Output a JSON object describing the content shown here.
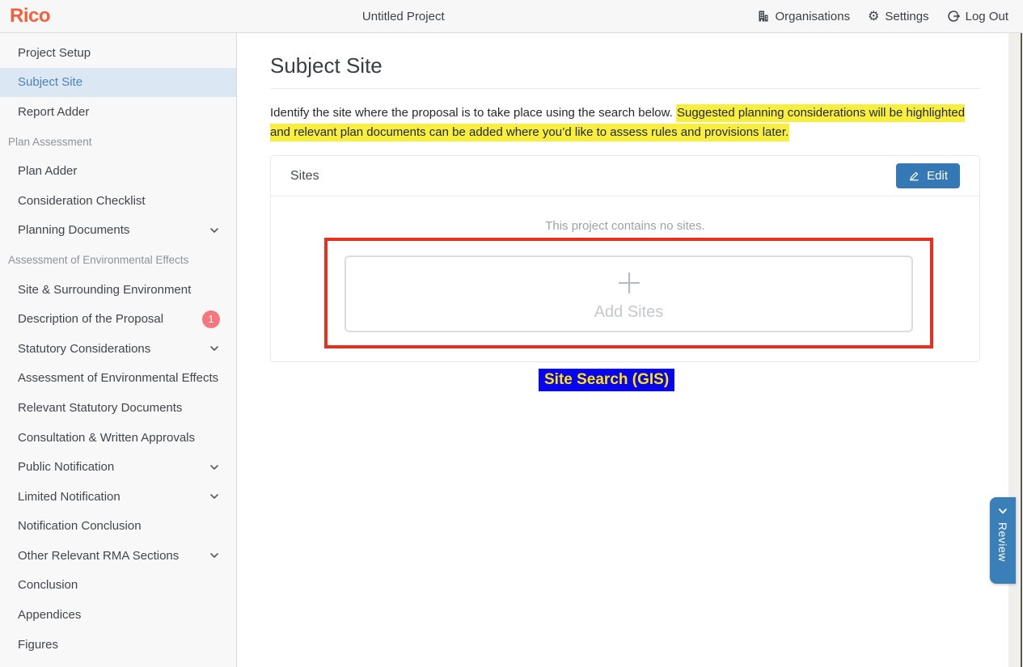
{
  "header": {
    "logo": "Rico",
    "project_title": "Untitled Project",
    "nav": [
      {
        "label": "Organisations",
        "icon": "buildings-icon"
      },
      {
        "label": "Settings",
        "icon": "gear-icon"
      },
      {
        "label": "Log Out",
        "icon": "logout-icon"
      }
    ]
  },
  "sidebar": {
    "items": [
      {
        "type": "link",
        "label": "Project Setup"
      },
      {
        "type": "link",
        "label": "Subject Site",
        "selected": true
      },
      {
        "type": "link",
        "label": "Report Adder"
      },
      {
        "type": "section",
        "label": "Plan Assessment"
      },
      {
        "type": "link",
        "label": "Plan Adder"
      },
      {
        "type": "link",
        "label": "Consideration Checklist"
      },
      {
        "type": "link",
        "label": "Planning Documents",
        "expandable": true
      },
      {
        "type": "section",
        "label": "Assessment of Environmental Effects"
      },
      {
        "type": "link",
        "label": "Site & Surrounding Environment"
      },
      {
        "type": "link",
        "label": "Description of the Proposal",
        "badge": "1"
      },
      {
        "type": "link",
        "label": "Statutory Considerations",
        "expandable": true
      },
      {
        "type": "link",
        "label": "Assessment of Environmental Effects"
      },
      {
        "type": "link",
        "label": "Relevant Statutory Documents"
      },
      {
        "type": "link",
        "label": "Consultation & Written Approvals"
      },
      {
        "type": "link",
        "label": "Public Notification",
        "expandable": true
      },
      {
        "type": "link",
        "label": "Limited Notification",
        "expandable": true
      },
      {
        "type": "link",
        "label": "Notification Conclusion"
      },
      {
        "type": "link",
        "label": "Other Relevant RMA Sections",
        "expandable": true
      },
      {
        "type": "link",
        "label": "Conclusion"
      },
      {
        "type": "link",
        "label": "Appendices"
      },
      {
        "type": "link",
        "label": "Figures"
      }
    ]
  },
  "main": {
    "title": "Subject Site",
    "intro_plain": "Identify the site where the proposal is to take place using the search below. ",
    "intro_highlighted": "Suggested planning considerations will be highlighted and relevant plan documents can be added where you’d like to assess rules and provisions later.",
    "sites_card": {
      "title": "Sites",
      "edit_label": "Edit",
      "edit_icon": "pencil-icon",
      "empty_message": "This project contains no sites.",
      "add_button_label": "Add Sites",
      "add_button_icon": "plus-icon"
    },
    "annotations": {
      "site_search_label": "Site Search (GIS)"
    }
  },
  "review_tab": {
    "label": "Review",
    "icon": "chevron-icon"
  },
  "colors": {
    "brand_orange": "#f4603a",
    "primary_blue": "#3578b6",
    "review_tab_blue": "#3b7fb9",
    "selected_item_bg": "#dbe8f4",
    "selected_item_text": "#4d82b2",
    "highlight_yellow": "#f8ee3e",
    "badge_red": "#f5777d",
    "annotation_red": "#e9301f",
    "annotation_blue_bg": "#0804ee",
    "annotation_yellow_text": "#ffe502"
  }
}
